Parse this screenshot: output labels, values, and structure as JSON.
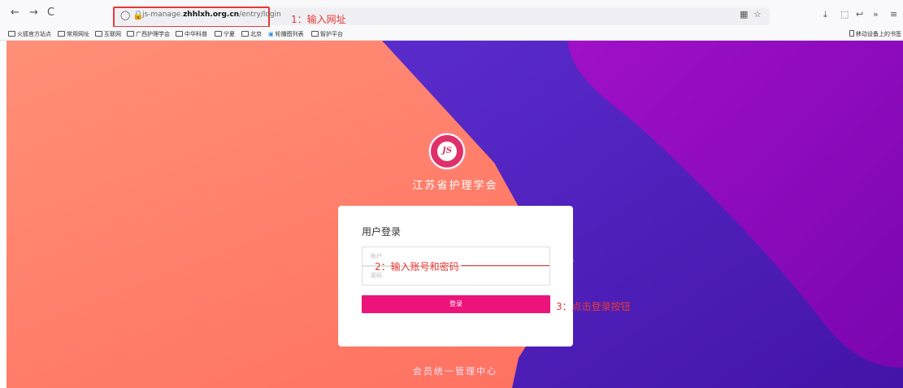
{
  "browser": {
    "url_prefix": "js-manage.",
    "url_domain": "zhhlxh.org.cn",
    "url_path": "/entry/login",
    "icons": {
      "back": "←",
      "forward": "→",
      "reload": "C",
      "shield": "◯",
      "lock": "🔒",
      "qr": "▦",
      "star": "☆",
      "download": "⤓",
      "extensions": "⬚",
      "share": "↩",
      "overflow": "»",
      "menu": "≡"
    }
  },
  "bookmarks": {
    "items": [
      "火狐官方站点",
      "常用网址",
      "互联网",
      "广西护理学会",
      "中华科普",
      "宁夏",
      "北京",
      "轮播图列表",
      "智护平台"
    ],
    "mobile": "移动设备上的书签"
  },
  "annotations": {
    "step1": "1：输入网址",
    "step2": "2：输入账号和密码",
    "step3": "3：点击登录按钮"
  },
  "page": {
    "logo_text": "JS",
    "org_name": "江苏省护理学会",
    "login_title": "用户登录",
    "account_placeholder": "账户",
    "password_placeholder": "密码",
    "login_button": "登录",
    "footer": "会员统一管理中心"
  },
  "colors": {
    "background_coral": "#ff8a6e",
    "background_blue": "#5a24c8",
    "background_purple": "#9a08c0",
    "login_button": "#ec137a",
    "annotation": "#e53935"
  }
}
